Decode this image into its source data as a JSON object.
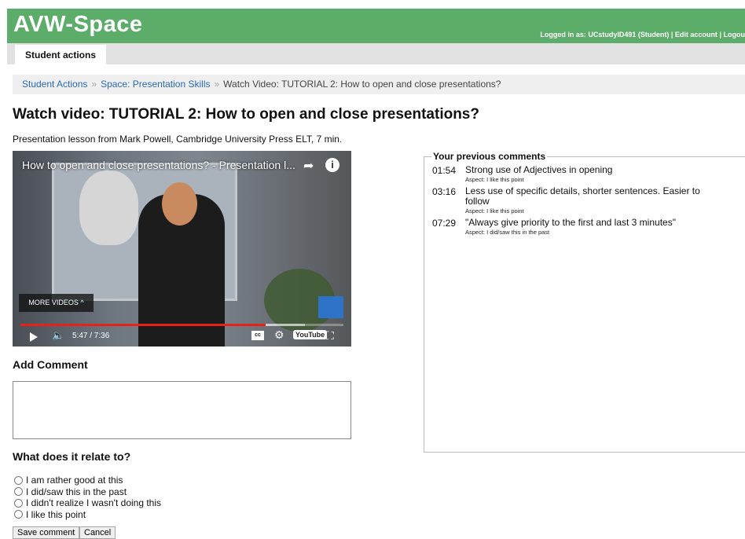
{
  "header": {
    "title": "AVW-Space",
    "logged_in_prefix": "Logged in as:",
    "user": "UCstudyID491 (Student)",
    "edit_account": "Edit account",
    "logout": "Logou",
    "bg_color": "#5cad6a"
  },
  "tabs": {
    "student_actions": "Student actions"
  },
  "breadcrumb": {
    "items": [
      "Student Actions",
      "Space: Presentation Skills"
    ],
    "current": "Watch Video: TUTORIAL 2: How to open and close presentations?",
    "separator": "»"
  },
  "page": {
    "title": "Watch video: TUTORIAL 2: How to open and close presentations?",
    "subtitle": "Presentation lesson from Mark Powell, Cambridge University Press ELT, 7 min."
  },
  "video": {
    "title": "How to open and close presentations? - Presentation l...",
    "more_videos": "MORE VIDEOS",
    "time": "5:47 / 7:36",
    "progress": 0.76,
    "buffered": 0.88,
    "youtube_label": "YouTube"
  },
  "add_comment": {
    "heading": "Add Comment",
    "value": ""
  },
  "relate": {
    "heading": "What does it relate to?",
    "options": [
      "I am rather good at this",
      "I did/saw this in the past",
      "I didn't realize I wasn't doing this",
      "I like this point"
    ]
  },
  "buttons": {
    "save": "Save comment",
    "cancel": "Cancel"
  },
  "previous": {
    "legend": "Your previous comments",
    "entries": [
      {
        "time": "01:54",
        "text": "Strong use of Adjectives in opening",
        "aspect": "Aspect: I like this point"
      },
      {
        "time": "03:16",
        "text": "Less use of specific details, shorter sentences. Easier to follow",
        "aspect": "Aspect: I like this point"
      },
      {
        "time": "07:29",
        "text": "\"Always give priority to the first and last 3 minutes\"",
        "aspect": "Aspect: I did/saw this in the past"
      }
    ]
  }
}
